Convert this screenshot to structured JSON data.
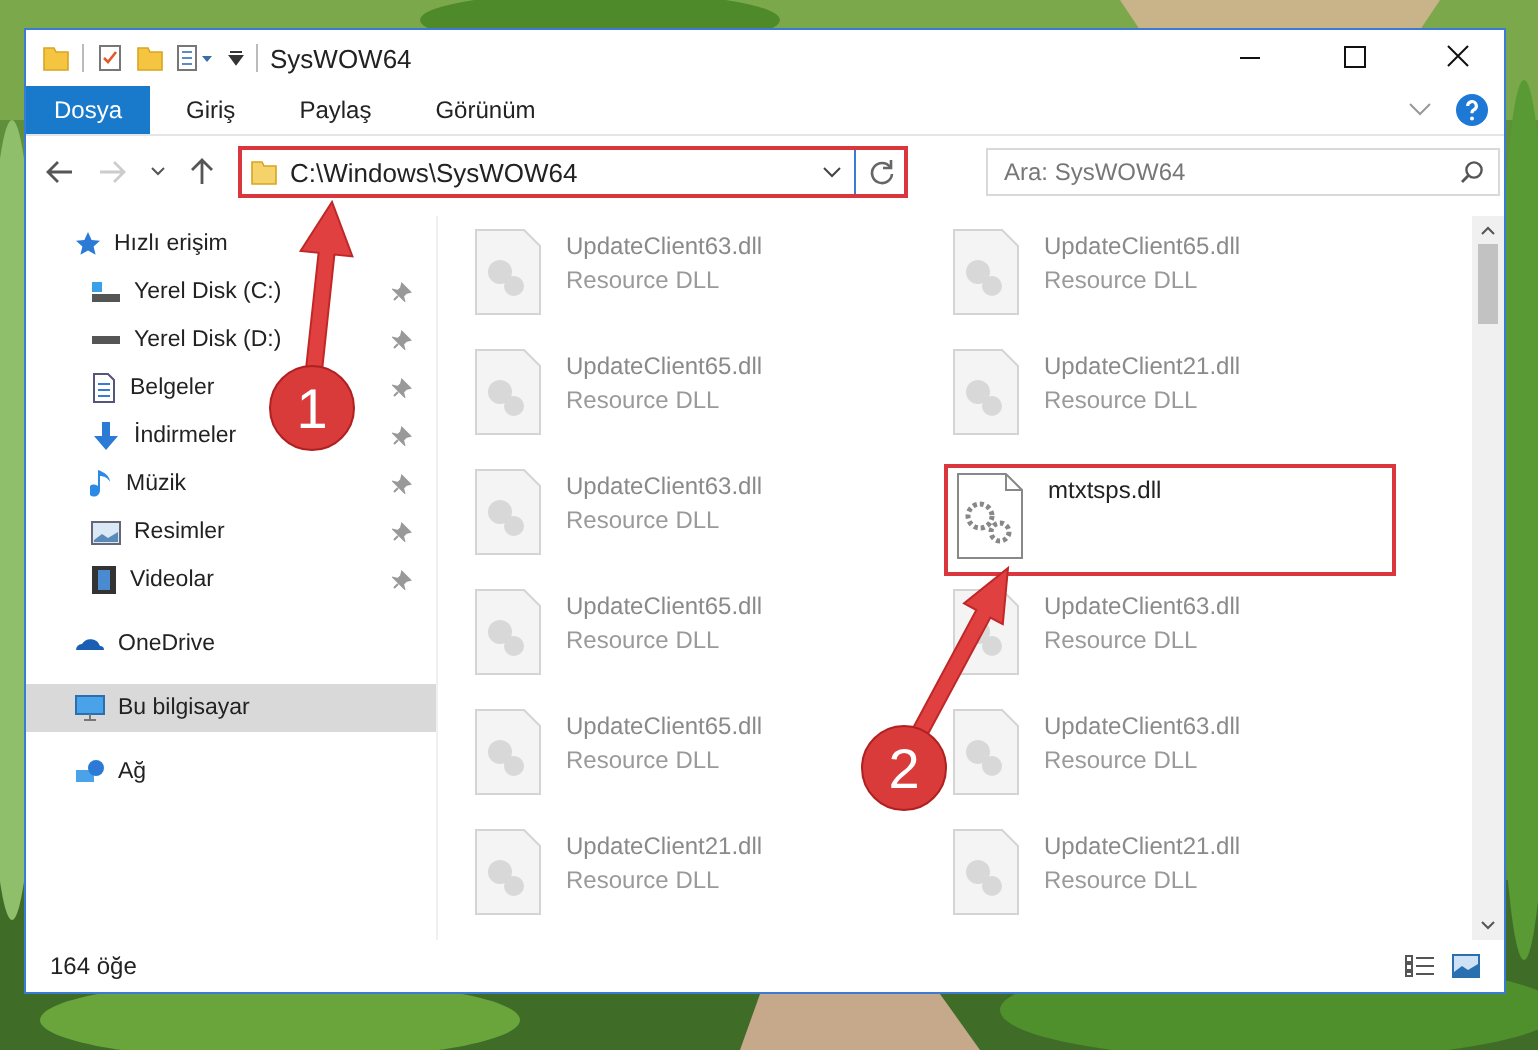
{
  "window": {
    "title": "SysWOW64"
  },
  "ribbon_tabs": [
    {
      "label": "Dosya",
      "selected": true
    },
    {
      "label": "Giriş",
      "selected": false
    },
    {
      "label": "Paylaş",
      "selected": false
    },
    {
      "label": "Görünüm",
      "selected": false
    }
  ],
  "address_bar": {
    "path": "C:\\Windows\\SysWOW64",
    "highlighted": true
  },
  "search": {
    "placeholder": "Ara: SysWOW64"
  },
  "sidebar": {
    "items": [
      {
        "label": "Hızlı erişim",
        "selected": false,
        "children": [
          {
            "label": "Yerel Disk (C:)",
            "pinned": true
          },
          {
            "label": "Yerel Disk (D:)",
            "pinned": true
          },
          {
            "label": "Belgeler",
            "pinned": true
          },
          {
            "label": "İndirmeler",
            "pinned": true
          },
          {
            "label": "Müzik",
            "pinned": true
          },
          {
            "label": "Resimler",
            "pinned": true
          },
          {
            "label": "Videolar",
            "pinned": true
          }
        ]
      },
      {
        "label": "OneDrive",
        "selected": false
      },
      {
        "label": "Bu bilgisayar",
        "selected": true
      },
      {
        "label": "Ağ",
        "selected": false
      }
    ]
  },
  "files": [
    {
      "name": "UpdateClient63.dll",
      "type": "Resource DLL",
      "dimmed": true,
      "highlighted": false
    },
    {
      "name": "UpdateClient65.dll",
      "type": "Resource DLL",
      "dimmed": true,
      "highlighted": false
    },
    {
      "name": "UpdateClient65.dll",
      "type": "Resource DLL",
      "dimmed": true,
      "highlighted": false
    },
    {
      "name": "UpdateClient21.dll",
      "type": "Resource DLL",
      "dimmed": true,
      "highlighted": false
    },
    {
      "name": "UpdateClient63.dll",
      "type": "Resource DLL",
      "dimmed": true,
      "highlighted": false
    },
    {
      "name": "mtxtsps.dll",
      "dimmed": false,
      "highlighted": true
    },
    {
      "name": "UpdateClient65.dll",
      "type": "Resource DLL",
      "dimmed": true,
      "highlighted": false
    },
    {
      "name": "UpdateClient63.dll",
      "type": "Resource DLL",
      "dimmed": true,
      "highlighted": false
    },
    {
      "name": "UpdateClient65.dll",
      "type": "Resource DLL",
      "dimmed": true,
      "highlighted": false
    },
    {
      "name": "UpdateClient63.dll",
      "type": "Resource DLL",
      "dimmed": true,
      "highlighted": false
    },
    {
      "name": "UpdateClient21.dll",
      "type": "Resource DLL",
      "dimmed": true,
      "highlighted": false
    },
    {
      "name": "UpdateClient21.dll",
      "type": "Resource DLL",
      "dimmed": true,
      "highlighted": false
    }
  ],
  "status_bar": {
    "count": "164 öğe"
  },
  "annotations": [
    {
      "number": "1"
    },
    {
      "number": "2"
    }
  ]
}
